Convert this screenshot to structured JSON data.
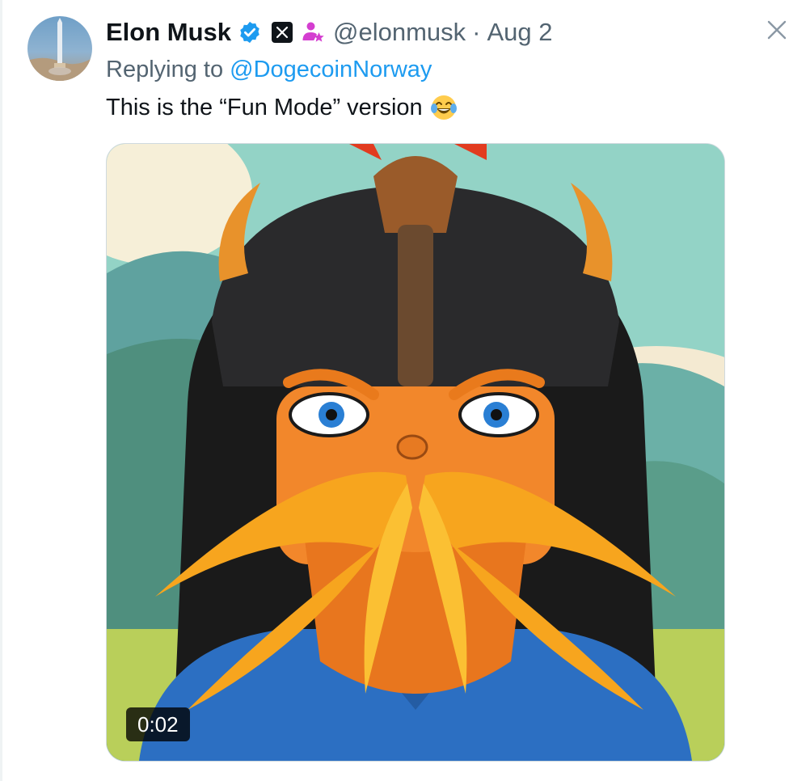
{
  "tweet": {
    "author_name": "Elon Musk",
    "handle": "@elonmusk",
    "separator": "·",
    "date": "Aug 2",
    "replying_prefix": "Replying to ",
    "replying_to": "@DogecoinNorway",
    "text": "This is the “Fun Mode” version",
    "text_emoji": "face-with-tears-of-joy-icon"
  },
  "media": {
    "type": "video",
    "duration": "0:02"
  },
  "colors": {
    "verified_blue": "#1d9bf0",
    "affiliate_pink": "#d43ed0",
    "muted_text": "#536471",
    "mention_blue": "#1d9bf0"
  }
}
